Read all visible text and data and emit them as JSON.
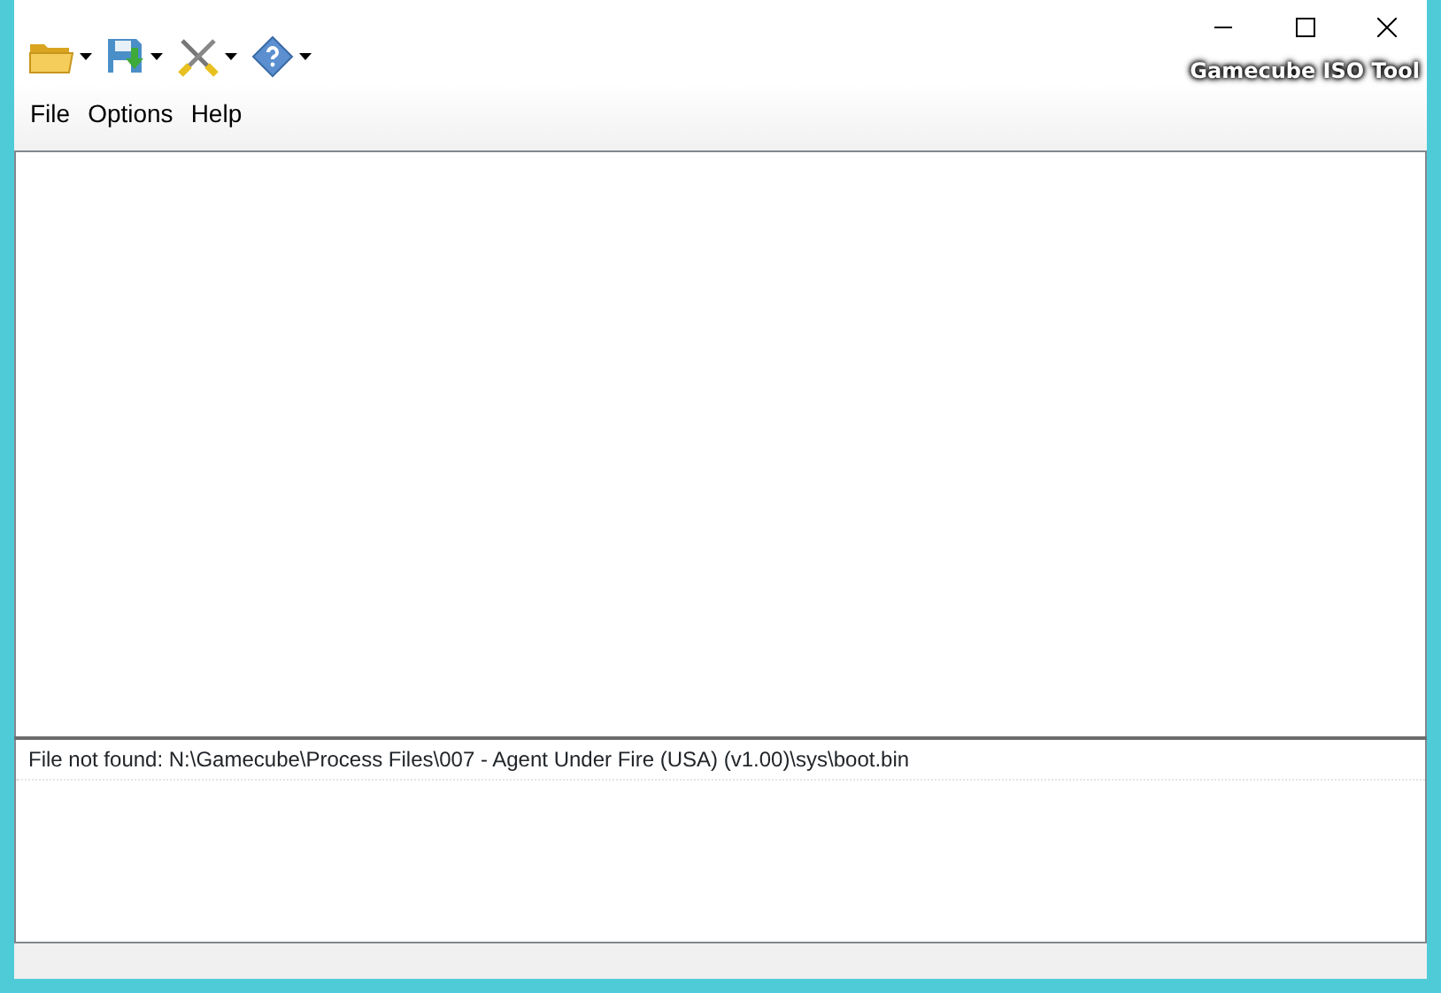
{
  "window": {
    "title": "Gamecube ISO Tool"
  },
  "toolbar": [
    {
      "kind": "open"
    },
    {
      "kind": "save"
    },
    {
      "kind": "tools"
    },
    {
      "kind": "help"
    }
  ],
  "menu": [
    "File",
    "Options",
    "Help"
  ],
  "log": [
    "File not found: N:\\Gamecube\\Process Files\\007 - Agent Under Fire (USA) (v1.00)\\sys\\boot.bin"
  ]
}
